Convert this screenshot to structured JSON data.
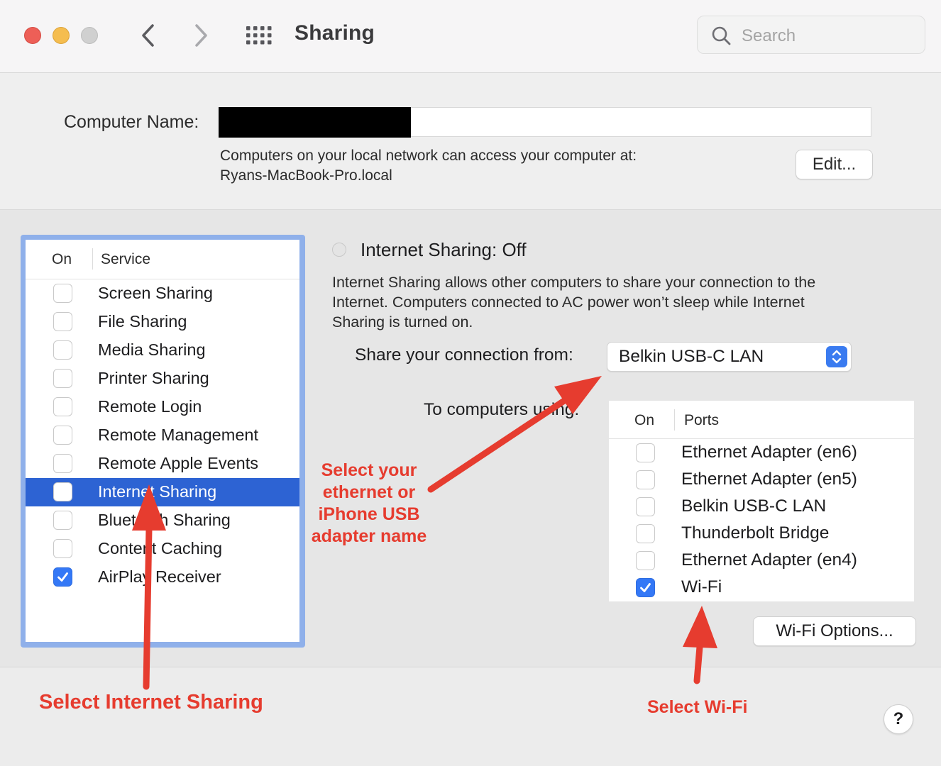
{
  "window": {
    "title": "Sharing"
  },
  "toolbar": {
    "search_placeholder": "Search"
  },
  "computer_name": {
    "label": "Computer Name:",
    "value": "",
    "access_line1": "Computers on your local network can access your computer at:",
    "access_line2": "Ryans-MacBook-Pro.local",
    "edit_label": "Edit..."
  },
  "services": {
    "header_on": "On",
    "header_service": "Service",
    "items": [
      {
        "label": "Screen Sharing",
        "checked": false,
        "selected": false
      },
      {
        "label": "File Sharing",
        "checked": false,
        "selected": false
      },
      {
        "label": "Media Sharing",
        "checked": false,
        "selected": false
      },
      {
        "label": "Printer Sharing",
        "checked": false,
        "selected": false
      },
      {
        "label": "Remote Login",
        "checked": false,
        "selected": false
      },
      {
        "label": "Remote Management",
        "checked": false,
        "selected": false
      },
      {
        "label": "Remote Apple Events",
        "checked": false,
        "selected": false
      },
      {
        "label": "Internet Sharing",
        "checked": false,
        "selected": true
      },
      {
        "label": "Bluetooth Sharing",
        "checked": false,
        "selected": false
      },
      {
        "label": "Content Caching",
        "checked": false,
        "selected": false
      },
      {
        "label": "AirPlay Receiver",
        "checked": true,
        "selected": false
      }
    ]
  },
  "internet_sharing": {
    "status": "Internet Sharing: Off",
    "description_lines": [
      "Internet Sharing allows other computers to share your connection to the",
      "Internet. Computers connected to AC power won’t sleep while Internet",
      "Sharing is turned on."
    ],
    "share_from_label": "Share your connection from:",
    "share_from_value": "Belkin USB-C LAN",
    "to_computers_label": "To computers using:",
    "ports_header_on": "On",
    "ports_header_ports": "Ports",
    "ports": [
      {
        "label": "Ethernet Adapter (en6)",
        "checked": false
      },
      {
        "label": "Ethernet Adapter (en5)",
        "checked": false
      },
      {
        "label": "Belkin USB-C LAN",
        "checked": false
      },
      {
        "label": "Thunderbolt Bridge",
        "checked": false
      },
      {
        "label": "Ethernet Adapter (en4)",
        "checked": false
      },
      {
        "label": "Wi-Fi",
        "checked": true
      }
    ],
    "wifi_options_label": "Wi-Fi Options..."
  },
  "help_label": "?",
  "annotations": {
    "middle_lines": [
      "Select your",
      "ethernet or",
      "iPhone USB",
      "adapter name"
    ],
    "bottom_left": "Select Internet Sharing",
    "bottom_right": "Select Wi-Fi",
    "color": "#e63c2f"
  },
  "colors": {
    "selection": "#2d63d3",
    "checkbox_checked": "#3478f6",
    "list_focus_ring": "#8fb0ea"
  }
}
